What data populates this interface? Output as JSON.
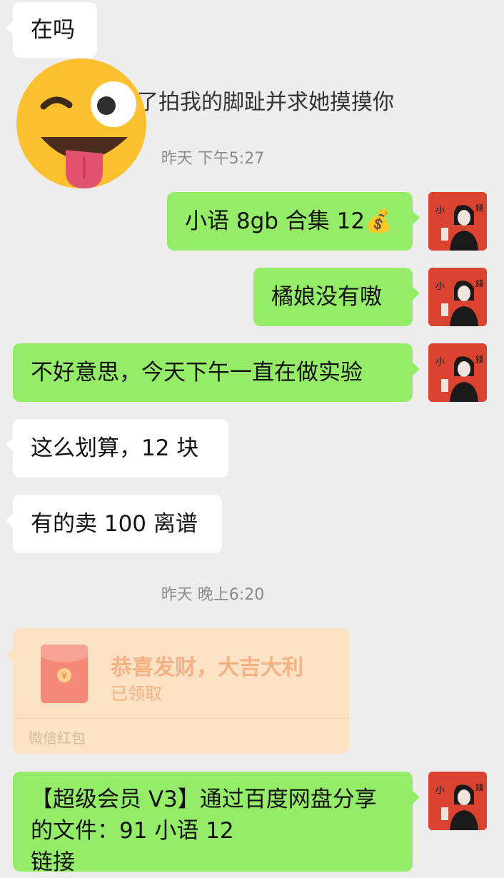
{
  "messages": {
    "m1": "在吗",
    "m2_partial": "了拍我的脚趾并求她摸摸你",
    "time1": "昨天 下午5:27",
    "m3": "小语 8gb 合集 12💰",
    "m4": "橘娘没有嗷",
    "m5": "不好意思，今天下午一直在做实验",
    "m6": "这么划算，12 块",
    "m7": "有的卖 100 离谱",
    "time2": "昨天 晚上6:20",
    "m8_line1": "【超级会员 V3】通过百度网盘分享",
    "m8_line2": "的文件：91 小语 12",
    "m8_line3": "链接"
  },
  "red_packet": {
    "title": "恭喜发财，大吉大利",
    "status": "已领取",
    "footer": "微信红包",
    "yuan_symbol": "¥"
  },
  "avatar": {
    "char_top": "小",
    "char_side": "錢"
  },
  "colors": {
    "background": "#ededed",
    "incoming_bubble": "#ffffff",
    "outgoing_bubble": "#95ec69",
    "red_packet_bg": "#fbe2c5",
    "avatar_bg": "#d9432f",
    "emoji_yellow": "#fbc02d"
  },
  "icons": {
    "wink_emoji": "winking-face-with-tongue",
    "money_bag": "money-bag"
  }
}
